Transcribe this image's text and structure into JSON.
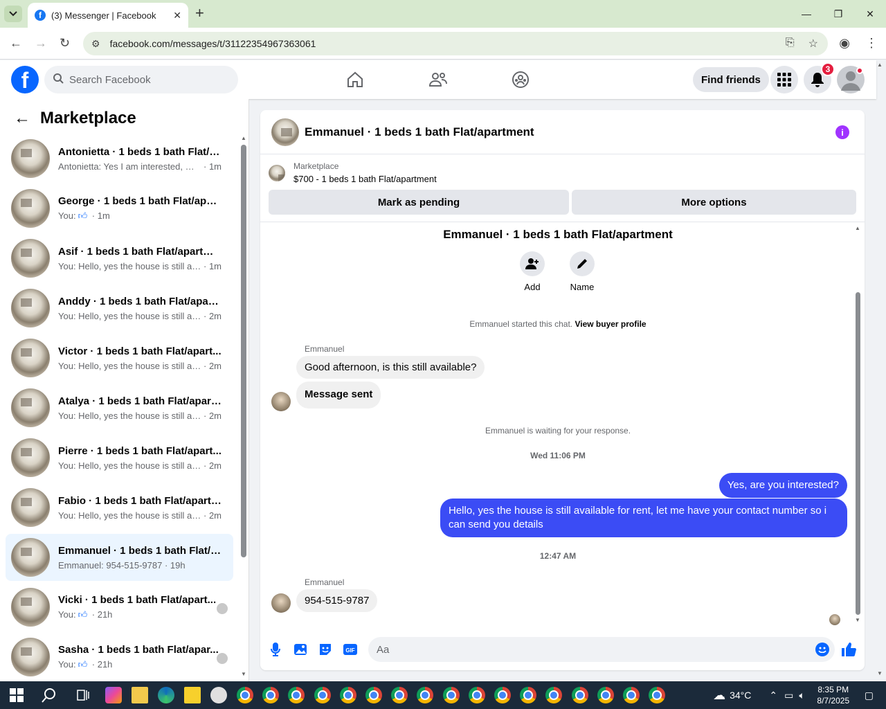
{
  "browser": {
    "tab_title": "(3) Messenger | Facebook",
    "url": "facebook.com/messages/t/31122354967363061"
  },
  "header": {
    "search_placeholder": "Search Facebook",
    "find_friends": "Find friends",
    "notif_count": "3"
  },
  "sidebar": {
    "title": "Marketplace",
    "conversations": [
      {
        "name": "Antonietta · 1 beds 1 bath Flat/a...",
        "preview": "Antonietta: Yes I am interested, my...",
        "time": "1m",
        "like": false
      },
      {
        "name": "George · 1 beds 1 bath Flat/apart...",
        "preview": "You:",
        "time": "1m",
        "like": true
      },
      {
        "name": "Asif · 1 beds 1 bath Flat/apartment",
        "preview": "You: Hello, yes the house is still av...",
        "time": "1m",
        "like": false
      },
      {
        "name": "Anddy · 1 beds 1 bath Flat/apart...",
        "preview": "You: Hello, yes the house is still av...",
        "time": "2m",
        "like": false
      },
      {
        "name": "Victor · 1 beds 1 bath Flat/apart...",
        "preview": "You: Hello, yes the house is still av...",
        "time": "2m",
        "like": false
      },
      {
        "name": "Atalya · 1 beds 1 bath Flat/apart...",
        "preview": "You: Hello, yes the house is still av...",
        "time": "2m",
        "like": false
      },
      {
        "name": "Pierre · 1 beds 1 bath Flat/apart...",
        "preview": "You: Hello, yes the house is still av...",
        "time": "2m",
        "like": false
      },
      {
        "name": "Fabio · 1 beds 1 bath Flat/apartm...",
        "preview": "You: Hello, yes the house is still av...",
        "time": "2m",
        "like": false
      },
      {
        "name": "Emmanuel · 1 beds 1 bath Flat/a...",
        "preview": "Emmanuel: 954-515-9787",
        "time": "19h",
        "like": false,
        "active": true
      },
      {
        "name": "Vicki · 1 beds 1 bath Flat/apart...",
        "preview": "You:",
        "time": "21h",
        "like": true
      },
      {
        "name": "Sasha · 1 beds 1 bath Flat/apar...",
        "preview": "You:",
        "time": "21h",
        "like": true
      }
    ]
  },
  "chat": {
    "title": "Emmanuel · 1 beds 1 bath Flat/apartment",
    "marketplace_label": "Marketplace",
    "listing": "$700 - 1 beds 1 bath Flat/apartment",
    "mark_pending": "Mark as pending",
    "more_options": "More options",
    "add_label": "Add",
    "name_label": "Name",
    "started_text": "Emmanuel started this chat.",
    "view_buyer": "View buyer profile",
    "sender": "Emmanuel",
    "msg1": "Good afternoon, is this still available?",
    "msg2": "Message sent",
    "waiting": "Emmanuel is waiting for your response.",
    "ts1": "Wed 11:06 PM",
    "out1": "Yes, are you interested?",
    "out2": "Hello, yes the house is still available for rent, let me have your contact number so i can send you details",
    "ts2": "12:47 AM",
    "msg3": "954-515-9787",
    "composer_placeholder": "Aa"
  },
  "taskbar": {
    "temp": "34°C",
    "time": "8:35 PM",
    "date": "8/7/2025"
  }
}
